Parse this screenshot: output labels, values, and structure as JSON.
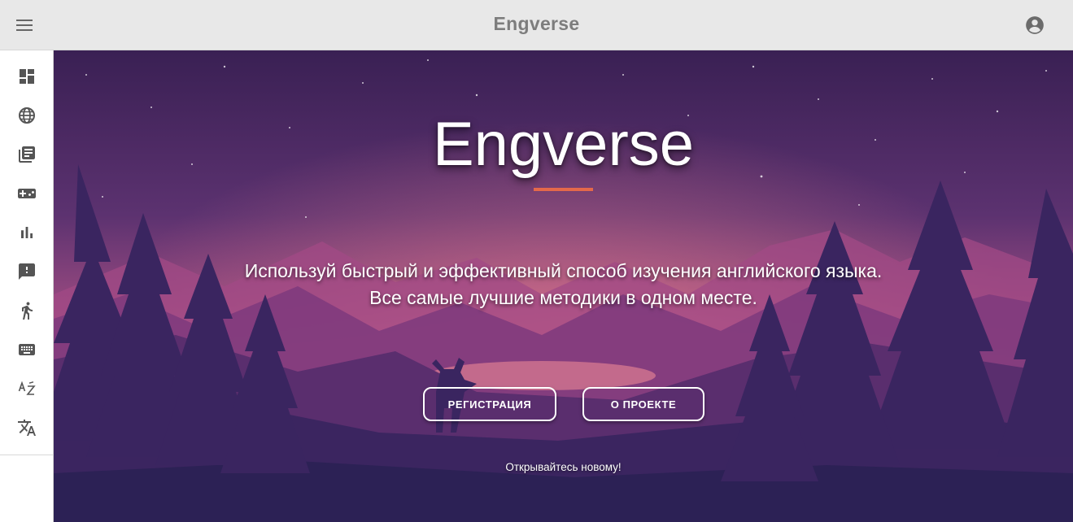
{
  "header": {
    "title": "Engverse",
    "menu_icon": "menu-icon",
    "account_icon": "account-circle-icon"
  },
  "sidebar": {
    "items": [
      {
        "icon": "dashboard-icon"
      },
      {
        "icon": "globe-icon"
      },
      {
        "icon": "library-books-icon"
      },
      {
        "icon": "gamepad-icon"
      },
      {
        "icon": "bar-chart-icon"
      },
      {
        "icon": "feedback-icon"
      },
      {
        "icon": "person-walking-icon"
      },
      {
        "icon": "keyboard-icon"
      },
      {
        "icon": "sort-az-icon"
      },
      {
        "icon": "translate-icon"
      }
    ]
  },
  "hero": {
    "title": "Engverse",
    "subtitle_line1": "Используй быстрый и эффективный способ изучения английского языка.",
    "subtitle_line2": "Все самые лучшие методики в одном месте.",
    "register_label": "РЕГИСТРАЦИЯ",
    "about_label": "О ПРОЕКТЕ",
    "tagline": "Открывайтесь новому!"
  },
  "colors": {
    "accent": "#e4694a",
    "topbar_bg": "#e8e8e8",
    "hero_sky_top": "#3d2257",
    "hero_glow": "#c9648a"
  }
}
